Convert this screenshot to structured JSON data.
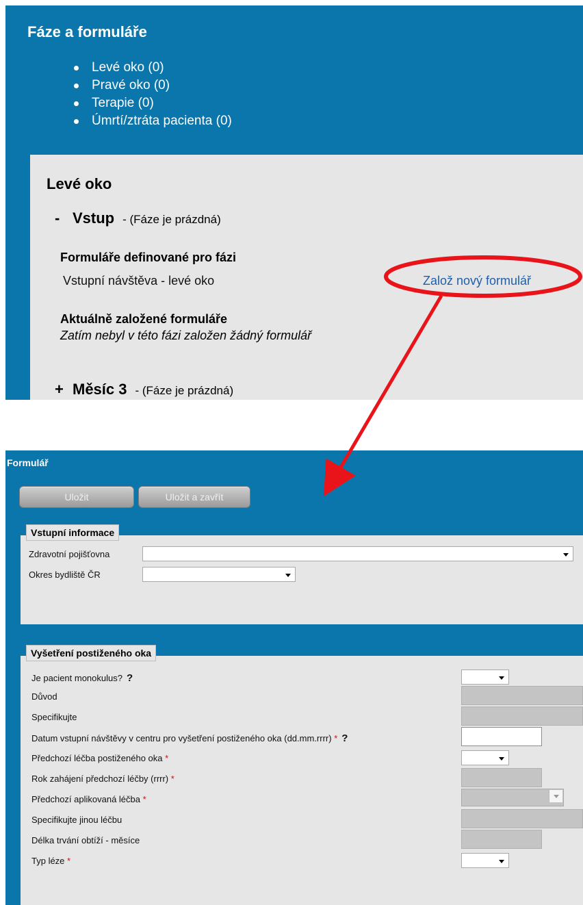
{
  "top": {
    "title": "Fáze a formuláře",
    "phases": [
      "Levé oko (0)",
      "Pravé oko (0)",
      "Terapie (0)",
      "Úmrtí/ztráta pacienta (0)"
    ],
    "section_title": "Levé oko",
    "phase1": {
      "sign": "-",
      "name": "Vstup",
      "status": "- (Fáze je prázdná)"
    },
    "defined_forms_title": "Formuláře definované pro fázi",
    "defined_form_name": "Vstupní návštěva - levé oko",
    "new_form_link": "Založ nový formulář",
    "current_forms_title": "Aktuálně založené formuláře",
    "current_forms_empty": "Zatím nebyl v této fázi založen žádný formulář",
    "phase2": {
      "sign": "+",
      "name": "Měsíc 3",
      "status": "- (Fáze je prázdná)"
    }
  },
  "form": {
    "title": "Formulář",
    "save_label": "Uložit",
    "save_close_label": "Uložit a zavřít",
    "section1": {
      "legend": "Vstupní informace",
      "insurance_label": "Zdravotní pojišťovna",
      "district_label": "Okres bydliště ČR"
    },
    "section2": {
      "legend": "Vyšetření postiženého oka",
      "fields": {
        "monokulus": "Je pacient monokulus?",
        "duvod": "Důvod",
        "specifikujte": "Specifikujte",
        "datum": "Datum vstupní návštěvy v centru pro vyšetření postiženého oka (dd.mm.rrrr)",
        "predchozi_lecba": "Předchozí léčba postiženého oka",
        "rok_zahajeni": "Rok zahájení předchozí léčby (rrrr)",
        "aplikovana_lecba": "Předchozí aplikovaná léčba",
        "jina_lecba": "Specifikujte jinou léčbu",
        "delka_obtizi": "Délka trvání obtíží - měsíce",
        "typ_leze": "Typ léze"
      },
      "required_mark": "*",
      "help_mark": "?"
    }
  },
  "colors": {
    "panel": "#0a76ac",
    "content": "#e6e6e6",
    "annotation": "#e8141a",
    "link": "#1f5fa8"
  }
}
